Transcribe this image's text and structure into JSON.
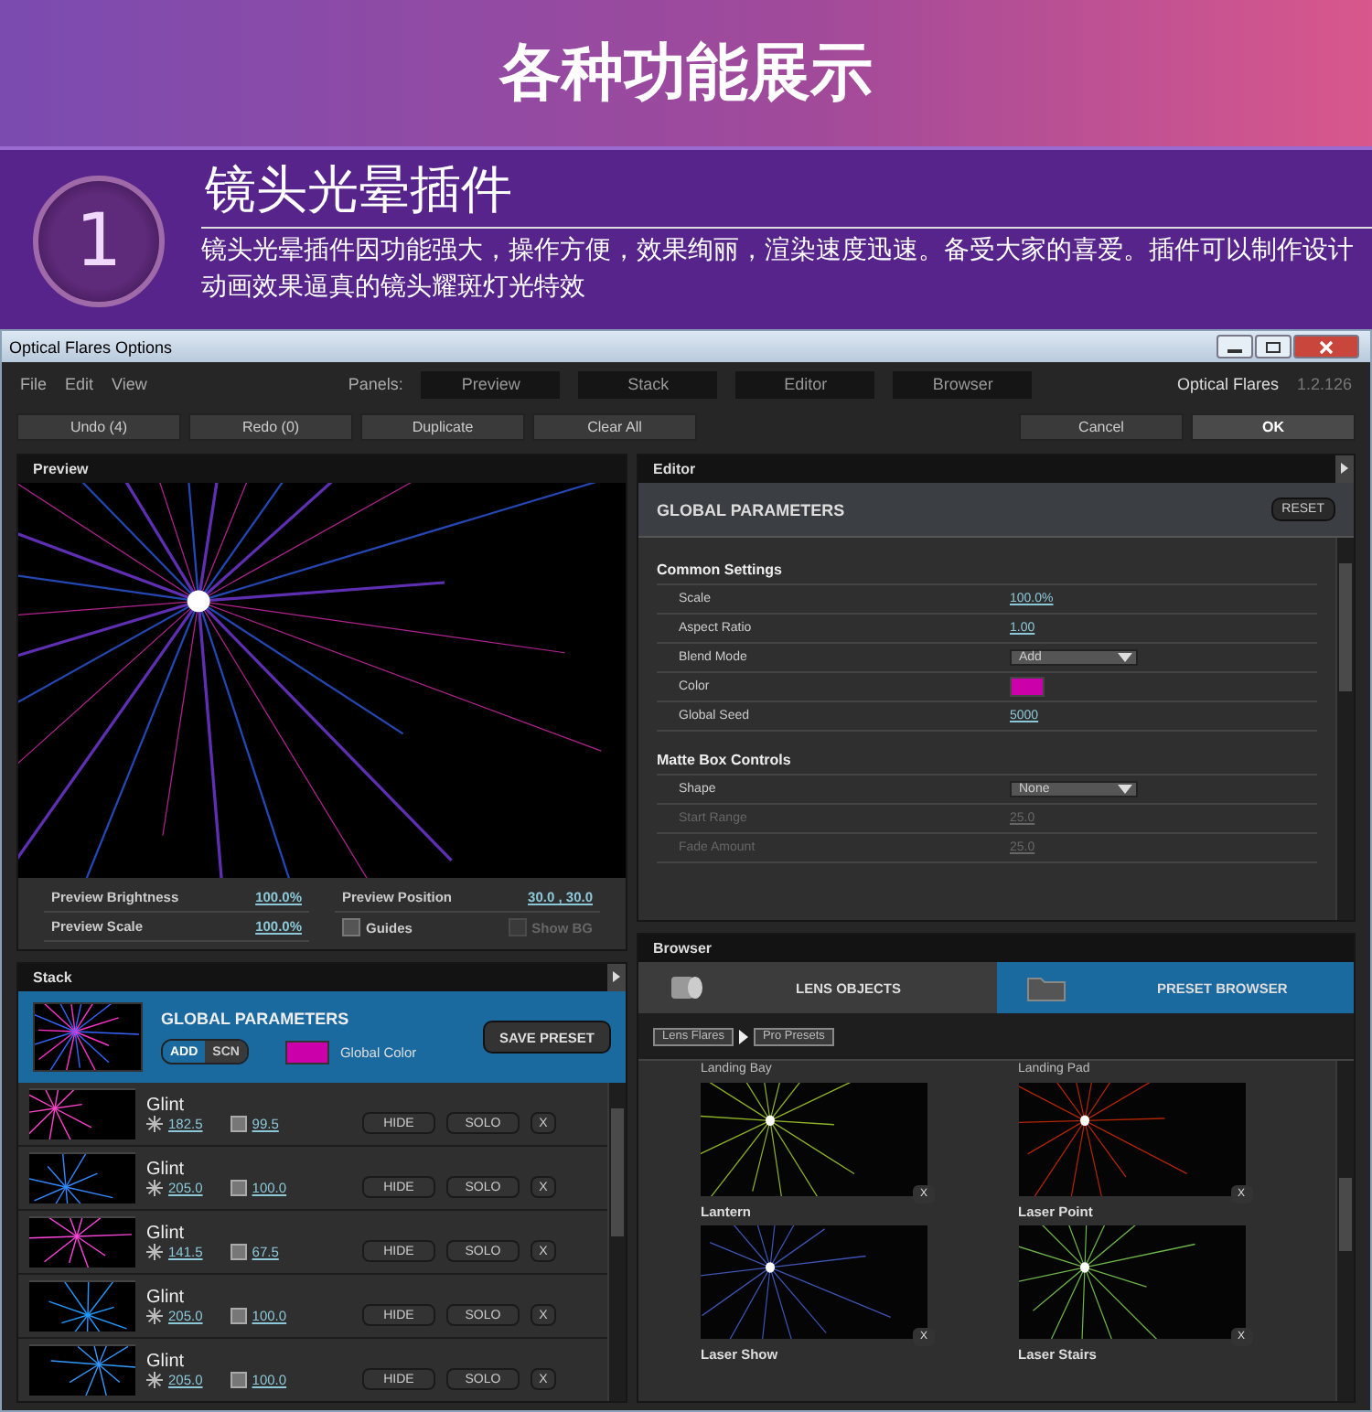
{
  "banner": {
    "title": "各种功能展示"
  },
  "section": {
    "number": "1",
    "title": "镜头光晕插件",
    "description": "镜头光晕插件因功能强大，操作方便，效果绚丽，渲染速度迅速。备受大家的喜爱。插件可以制作设计动画效果逼真的镜头耀斑灯光特效"
  },
  "window": {
    "title": "Optical Flares Options",
    "menu": [
      "File",
      "Edit",
      "View"
    ],
    "panels_label": "Panels:",
    "panel_buttons": [
      "Preview",
      "Stack",
      "Editor",
      "Browser"
    ],
    "app_name": "Optical Flares",
    "version": "1.2.126",
    "toolbar_left": [
      "Undo (4)",
      "Redo (0)",
      "Duplicate",
      "Clear All"
    ],
    "toolbar_right": [
      "Cancel",
      "OK"
    ]
  },
  "preview": {
    "header": "Preview",
    "settings": [
      {
        "label": "Preview Brightness",
        "value": "100.0%"
      },
      {
        "label": "Preview Position",
        "value": "30.0 , 30.0"
      },
      {
        "label": "Preview Scale",
        "value": "100.0%"
      }
    ],
    "checkboxes": [
      {
        "label": "Guides",
        "checked": false,
        "disabled": false
      },
      {
        "label": "Show BG",
        "checked": false,
        "disabled": true
      }
    ]
  },
  "editor": {
    "header": "Editor",
    "title": "GLOBAL PARAMETERS",
    "reset": "RESET",
    "groups": [
      {
        "title": "Common Settings",
        "rows": [
          {
            "label": "Scale",
            "kind": "number",
            "value": "100.0%",
            "disabled": false
          },
          {
            "label": "Aspect Ratio",
            "kind": "number",
            "value": "1.00",
            "disabled": false
          },
          {
            "label": "Blend Mode",
            "kind": "dropdown",
            "value": "Add",
            "disabled": false
          },
          {
            "label": "Color",
            "kind": "color",
            "color": "#cc00aa",
            "disabled": false
          },
          {
            "label": "Global Seed",
            "kind": "number",
            "value": "5000",
            "disabled": false
          }
        ]
      },
      {
        "title": "Matte Box Controls",
        "rows": [
          {
            "label": "Shape",
            "kind": "dropdown",
            "value": "None",
            "disabled": false
          },
          {
            "label": "Start Range",
            "kind": "number",
            "value": "25.0",
            "disabled": true
          },
          {
            "label": "Fade Amount",
            "kind": "number",
            "value": "25.0",
            "disabled": true
          }
        ]
      }
    ]
  },
  "stack": {
    "header": "Stack",
    "global": {
      "title": "GLOBAL PARAMETERS",
      "modes": [
        {
          "label": "ADD",
          "selected": true
        },
        {
          "label": "SCN",
          "selected": false
        }
      ],
      "color": "#cc00aa",
      "color_label": "Global Color",
      "save": "SAVE PRESET"
    },
    "items": [
      {
        "name": "Glint",
        "brightness": "182.5",
        "scale": "99.5",
        "hide": "HIDE",
        "solo": "SOLO",
        "remove": "X"
      },
      {
        "name": "Glint",
        "brightness": "205.0",
        "scale": "100.0",
        "hide": "HIDE",
        "solo": "SOLO",
        "remove": "X"
      },
      {
        "name": "Glint",
        "brightness": "141.5",
        "scale": "67.5",
        "hide": "HIDE",
        "solo": "SOLO",
        "remove": "X"
      },
      {
        "name": "Glint",
        "brightness": "205.0",
        "scale": "100.0",
        "hide": "HIDE",
        "solo": "SOLO",
        "remove": "X"
      },
      {
        "name": "Glint",
        "brightness": "205.0",
        "scale": "100.0",
        "hide": "HIDE",
        "solo": "SOLO",
        "remove": "X"
      }
    ]
  },
  "browser": {
    "header": "Browser",
    "tabs": [
      {
        "label": "LENS OBJECTS",
        "selected": false
      },
      {
        "label": "PRESET BROWSER",
        "selected": true
      }
    ],
    "breadcrumb": [
      "Lens Flares",
      "Pro Presets"
    ],
    "cut_labels": [
      "Landing Bay",
      "Landing Pad"
    ],
    "presets": [
      {
        "name": "Lantern",
        "remove": "X"
      },
      {
        "name": "Laser Point",
        "remove": "X"
      },
      {
        "name": "Laser Show",
        "remove": "X"
      },
      {
        "name": "Laser Stairs",
        "remove": "X"
      }
    ]
  }
}
